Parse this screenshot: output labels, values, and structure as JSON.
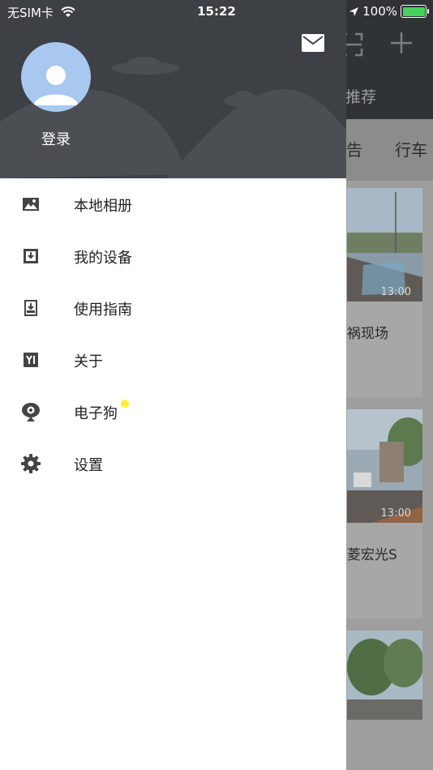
{
  "status_bar": {
    "carrier": "无SIM卡",
    "time": "15:22",
    "battery": "100%"
  },
  "background": {
    "tab_recommend": "推荐",
    "nav_items": [
      "告",
      "行车"
    ],
    "cards": [
      {
        "timestamp": "13:00",
        "title": "祸现场"
      },
      {
        "timestamp": "13:00",
        "title": "菱宏光S"
      }
    ]
  },
  "drawer": {
    "login_label": "登录",
    "menu": [
      {
        "label": "本地相册",
        "icon": "photo-album-icon"
      },
      {
        "label": "我的设备",
        "icon": "device-download-icon"
      },
      {
        "label": "使用指南",
        "icon": "guide-book-icon"
      },
      {
        "label": "关于",
        "icon": "yi-logo-icon"
      },
      {
        "label": "电子狗",
        "icon": "webcam-icon"
      },
      {
        "label": "设置",
        "icon": "gear-icon"
      }
    ]
  }
}
